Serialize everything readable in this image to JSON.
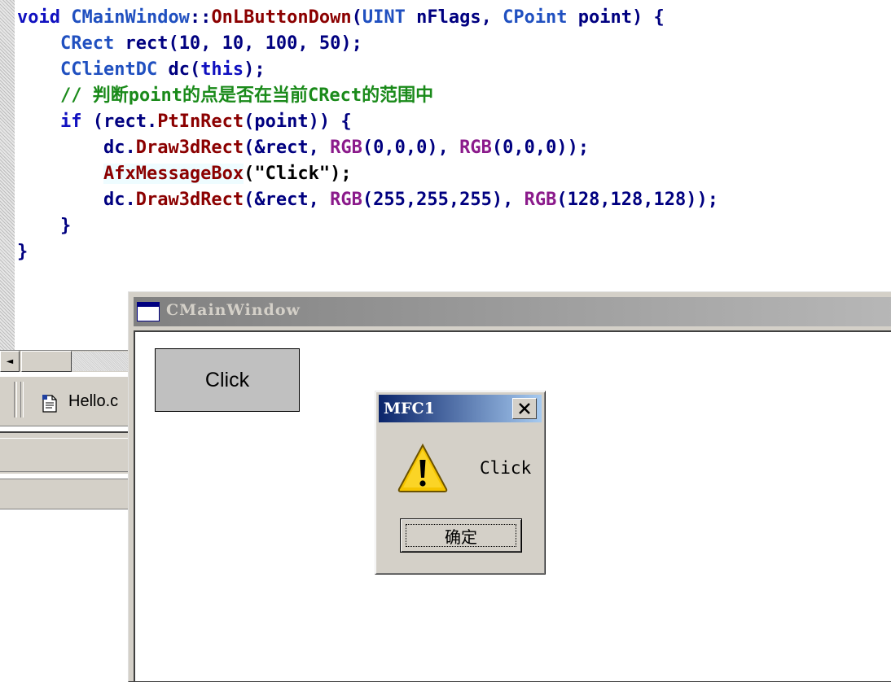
{
  "code": {
    "lines": [
      [
        {
          "t": "void ",
          "c": "kw"
        },
        {
          "t": "CMainWindow",
          "c": "ty"
        },
        {
          "t": "::",
          "c": "pl"
        },
        {
          "t": "OnLButtonDown",
          "c": "fn"
        },
        {
          "t": "(",
          "c": "pl"
        },
        {
          "t": "UINT",
          "c": "ty"
        },
        {
          "t": " nFlags, ",
          "c": "pl"
        },
        {
          "t": "CPoint",
          "c": "ty"
        },
        {
          "t": " point) {",
          "c": "pl"
        }
      ],
      [
        {
          "t": "    ",
          "c": "pl"
        },
        {
          "t": "CRect",
          "c": "ty"
        },
        {
          "t": " rect(10, 10, 100, 50);",
          "c": "pl"
        }
      ],
      [
        {
          "t": "    ",
          "c": "pl"
        },
        {
          "t": "CClientDC",
          "c": "ty"
        },
        {
          "t": " dc(",
          "c": "pl"
        },
        {
          "t": "this",
          "c": "kw"
        },
        {
          "t": ");",
          "c": "pl"
        }
      ],
      [
        {
          "t": "    ",
          "c": "pl"
        },
        {
          "t": "// 判断point的点是否在当前CRect的范围中",
          "c": "cm"
        }
      ],
      [
        {
          "t": "    ",
          "c": "pl"
        },
        {
          "t": "if",
          "c": "kw"
        },
        {
          "t": " (rect.",
          "c": "pl"
        },
        {
          "t": "PtInRect",
          "c": "fn"
        },
        {
          "t": "(point)) {",
          "c": "pl"
        }
      ],
      [
        {
          "t": "        ",
          "c": "pl"
        },
        {
          "t": "dc.",
          "c": "pl"
        },
        {
          "t": "Draw3dRect",
          "c": "fn"
        },
        {
          "t": "(&rect, ",
          "c": "pl"
        },
        {
          "t": "RGB",
          "c": "mac"
        },
        {
          "t": "(0,0,0), ",
          "c": "pl"
        },
        {
          "t": "RGB",
          "c": "mac"
        },
        {
          "t": "(0,0,0));",
          "c": "pl"
        }
      ],
      [
        {
          "t": "        ",
          "c": "pl"
        },
        {
          "t": "AfxMessageBox",
          "c": "fn",
          "hl": true
        },
        {
          "t": "(\"Click\");",
          "c": "str"
        }
      ],
      [
        {
          "t": "        ",
          "c": "pl"
        },
        {
          "t": "dc.",
          "c": "pl"
        },
        {
          "t": "Draw3dRect",
          "c": "fn"
        },
        {
          "t": "(&rect, ",
          "c": "pl"
        },
        {
          "t": "RGB",
          "c": "mac"
        },
        {
          "t": "(255,255,255), ",
          "c": "pl"
        },
        {
          "t": "RGB",
          "c": "mac"
        },
        {
          "t": "(128,128,128));",
          "c": "pl"
        }
      ],
      [
        {
          "t": "    }",
          "c": "pl"
        }
      ],
      [
        {
          "t": "}",
          "c": "pl"
        }
      ]
    ]
  },
  "ide": {
    "file_tab_label": "Hello.c",
    "scroll_left_arrow": "◄"
  },
  "main_window": {
    "title": "CMainWindow",
    "click_rect_label": "Click"
  },
  "message_box": {
    "title": "MFC1",
    "close_glyph": "✕",
    "message": "Click",
    "ok_label": "确定",
    "icon": "warning-icon"
  },
  "colors": {
    "keyword": "#1010c0",
    "type": "#2050c0",
    "function": "#8b0000",
    "macro": "#8b1a8b",
    "comment": "#1a8a1a",
    "dialog_title_from": "#0a246a",
    "dialog_title_to": "#a6caf0"
  }
}
